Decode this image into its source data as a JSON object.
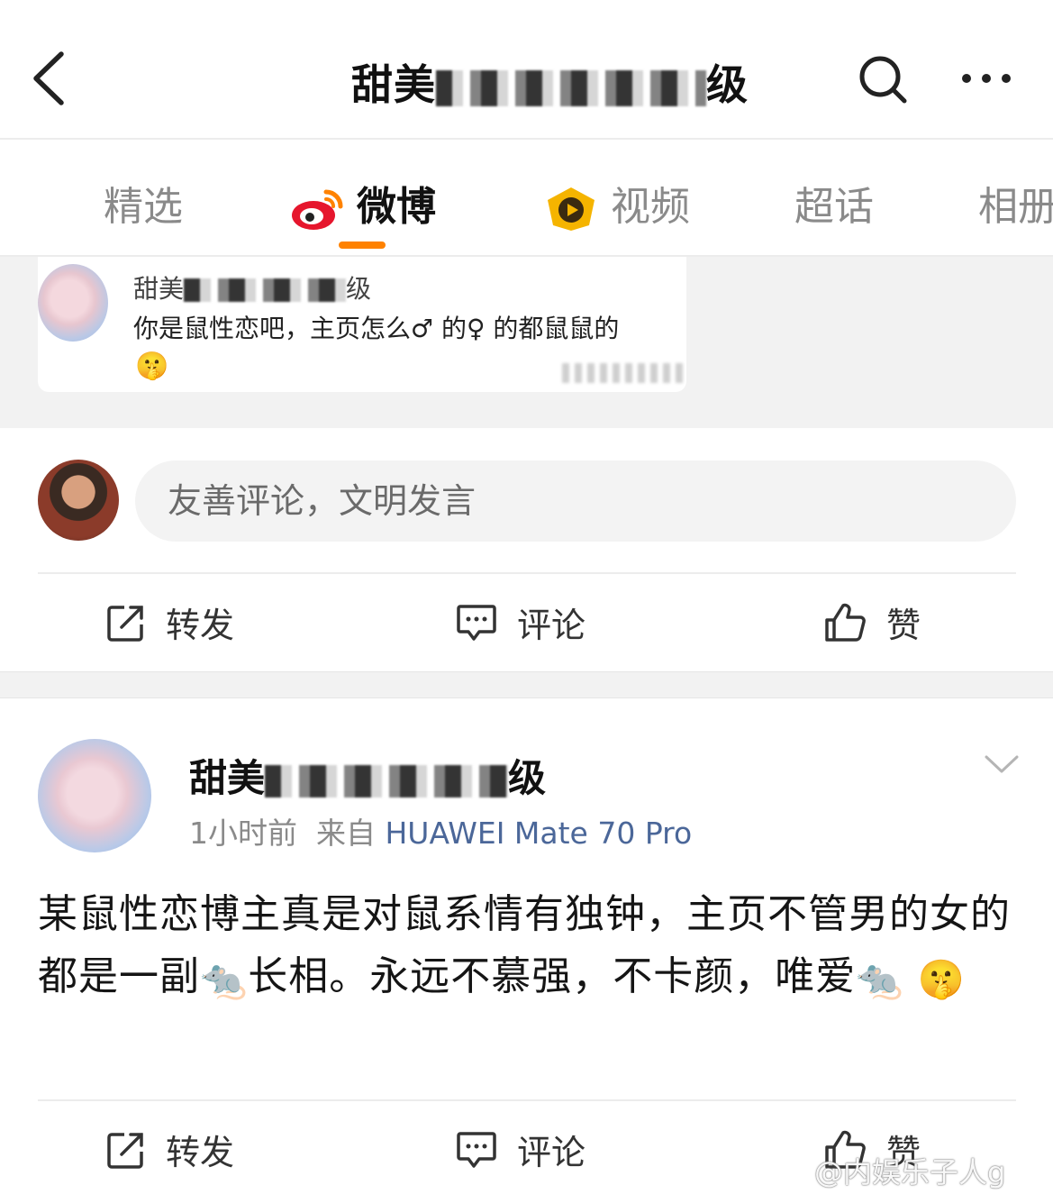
{
  "header": {
    "title_prefix": "甜美",
    "title_suffix": "级"
  },
  "tabs": [
    {
      "label": "精选"
    },
    {
      "label": "微博",
      "active": true
    },
    {
      "label": "视频"
    },
    {
      "label": "超话"
    },
    {
      "label": "相册"
    }
  ],
  "quoted_comment": {
    "user_prefix": "甜美",
    "user_suffix": "级",
    "text": "你是鼠性恋吧，主页怎么♂ 的♀ 的都鼠鼠的",
    "emoji": "🤫"
  },
  "comment_box": {
    "placeholder": "友善评论，文明发言"
  },
  "actions": {
    "repost": "转发",
    "comment": "评论",
    "like": "赞"
  },
  "post": {
    "user_prefix": "甜美",
    "user_suffix": "级",
    "time": "1小时前",
    "from_label": "来自",
    "device": "HUAWEI Mate 70 Pro",
    "body_part1": "某鼠性恋博主真是对鼠系情有独钟，主页不管男的女的都是一副",
    "rat_emoji": "🐀",
    "body_part2": "长相。永远不慕强，不卡颜，唯爱",
    "shush_emoji": "🤫"
  },
  "watermark": "@内娱乐子人g",
  "colors": {
    "accent_orange": "#ff8200",
    "device_blue": "#4b6799",
    "weibo_red": "#e6162d"
  }
}
